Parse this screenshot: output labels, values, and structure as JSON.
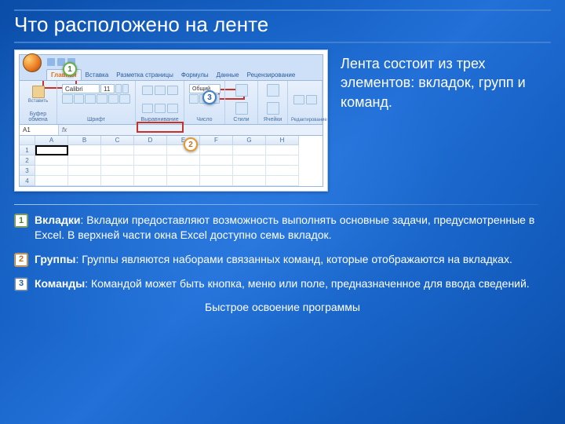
{
  "title": "Что расположено на ленте",
  "intro": "Лента состоит из трех элементов: вкладок, групп и команд.",
  "excel": {
    "tabs": [
      "Главная",
      "Вставка",
      "Разметка страницы",
      "Формулы",
      "Данные",
      "Рецензирование"
    ],
    "active_tab": "Главная",
    "groups": {
      "clipboard": "Буфер обмена",
      "clipboard_btn": "Вставить",
      "font": "Шрифт",
      "font_name": "Calibri",
      "font_size": "11",
      "alignment": "Выравнивание",
      "number": "Число",
      "number_fmt": "Общий",
      "styles": "Стили",
      "cells": "Ячейки",
      "editing": "Редактирование"
    },
    "name_box": "A1",
    "columns": [
      "A",
      "B",
      "C",
      "D",
      "E",
      "F",
      "G",
      "H"
    ],
    "rows": [
      "1",
      "2",
      "3",
      "4"
    ]
  },
  "callouts": {
    "c1": "1",
    "c2": "2",
    "c3": "3"
  },
  "bullets": [
    {
      "num": "1",
      "label": "Вкладки",
      "text": ": Вкладки предоставляют возможность выполнять основные задачи, предусмотренные в Excel. В верхней части окна Excel доступно семь вкладок."
    },
    {
      "num": "2",
      "label": "Группы",
      "text": ": Группы являются наборами связанных команд, которые отображаются на вкладках."
    },
    {
      "num": "3",
      "label": "Команды",
      "text": ": Командой может быть кнопка, меню или поле, предназначенное для ввода сведений."
    }
  ],
  "footer": "Быстрое освоение программы"
}
